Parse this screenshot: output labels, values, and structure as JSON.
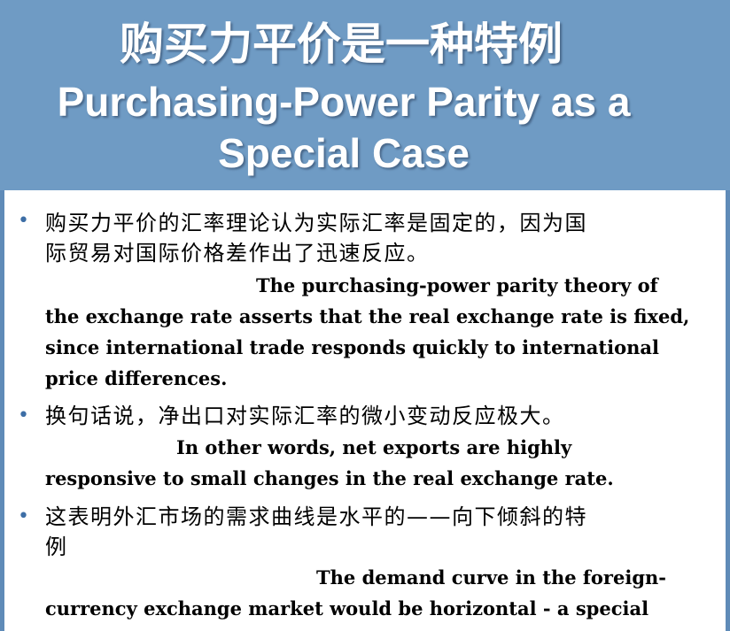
{
  "title": {
    "chinese": "购买力平价是一种特例",
    "english_line1": "Purchasing-Power Parity as a",
    "english_line2": "Special Case"
  },
  "bullets": [
    {
      "marker": "•",
      "chinese_lines": [
        "购买力平价的汇率理论认为实际汇率是固定的，因为国",
        "际贸易对国际价格差作出了迅速反应。"
      ],
      "english_lines": [
        "The purchasing-power parity theory of",
        "the exchange rate asserts that the real exchange rate is fixed,",
        "since international trade responds quickly to international",
        "price differences."
      ]
    },
    {
      "marker": "•",
      "chinese_lines": [
        "换句话说，净出口对实际汇率的微小变动反应极大。"
      ],
      "english_lines": [
        "In other words,  net exports are highly",
        "responsive to small changes in the real exchange rate."
      ]
    },
    {
      "marker": "•",
      "chinese_lines": [
        "这表明外汇市场的需求曲线是水平的——向下倾斜的特",
        "例"
      ],
      "english_lines": [
        "The demand curve in the foreign-",
        "currency exchange market would be horizontal - a special"
      ]
    }
  ],
  "colors": {
    "header_background": "#6f9bc4",
    "title_text": "#ffffff",
    "bullet_marker": "#3d6ea6",
    "body_text": "#000000",
    "frame_border": "#5f8bb8"
  }
}
